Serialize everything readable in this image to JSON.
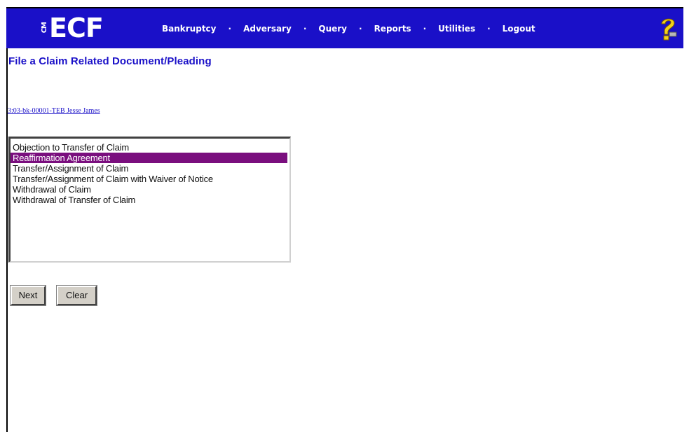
{
  "header": {
    "logo_prefix": "CM",
    "logo_text": "ECF",
    "menu": [
      {
        "label": "Bankruptcy"
      },
      {
        "label": "Adversary"
      },
      {
        "label": "Query"
      },
      {
        "label": "Reports"
      },
      {
        "label": "Utilities"
      },
      {
        "label": "Logout"
      }
    ],
    "separator": "·",
    "help_icon": "question-mark-icon"
  },
  "page": {
    "title": "File a Claim Related Document/Pleading",
    "case_link": "3:03-bk-00001-TEB Jesse James"
  },
  "event_list": {
    "options": [
      {
        "label": "Objection to Transfer of Claim",
        "selected": false
      },
      {
        "label": "Reaffirmation Agreement",
        "selected": true
      },
      {
        "label": "Transfer/Assignment of Claim",
        "selected": false
      },
      {
        "label": "Transfer/Assignment of Claim with Waiver of Notice",
        "selected": false
      },
      {
        "label": "Withdrawal of Claim",
        "selected": false
      },
      {
        "label": "Withdrawal of Transfer of Claim",
        "selected": false
      }
    ]
  },
  "buttons": {
    "next_label": "Next",
    "clear_label": "Clear"
  },
  "colors": {
    "menubar": "#1a10c8",
    "title": "#1a10c8",
    "selected_option": "#7a0e7e",
    "help_icon": "#f2d21a"
  }
}
